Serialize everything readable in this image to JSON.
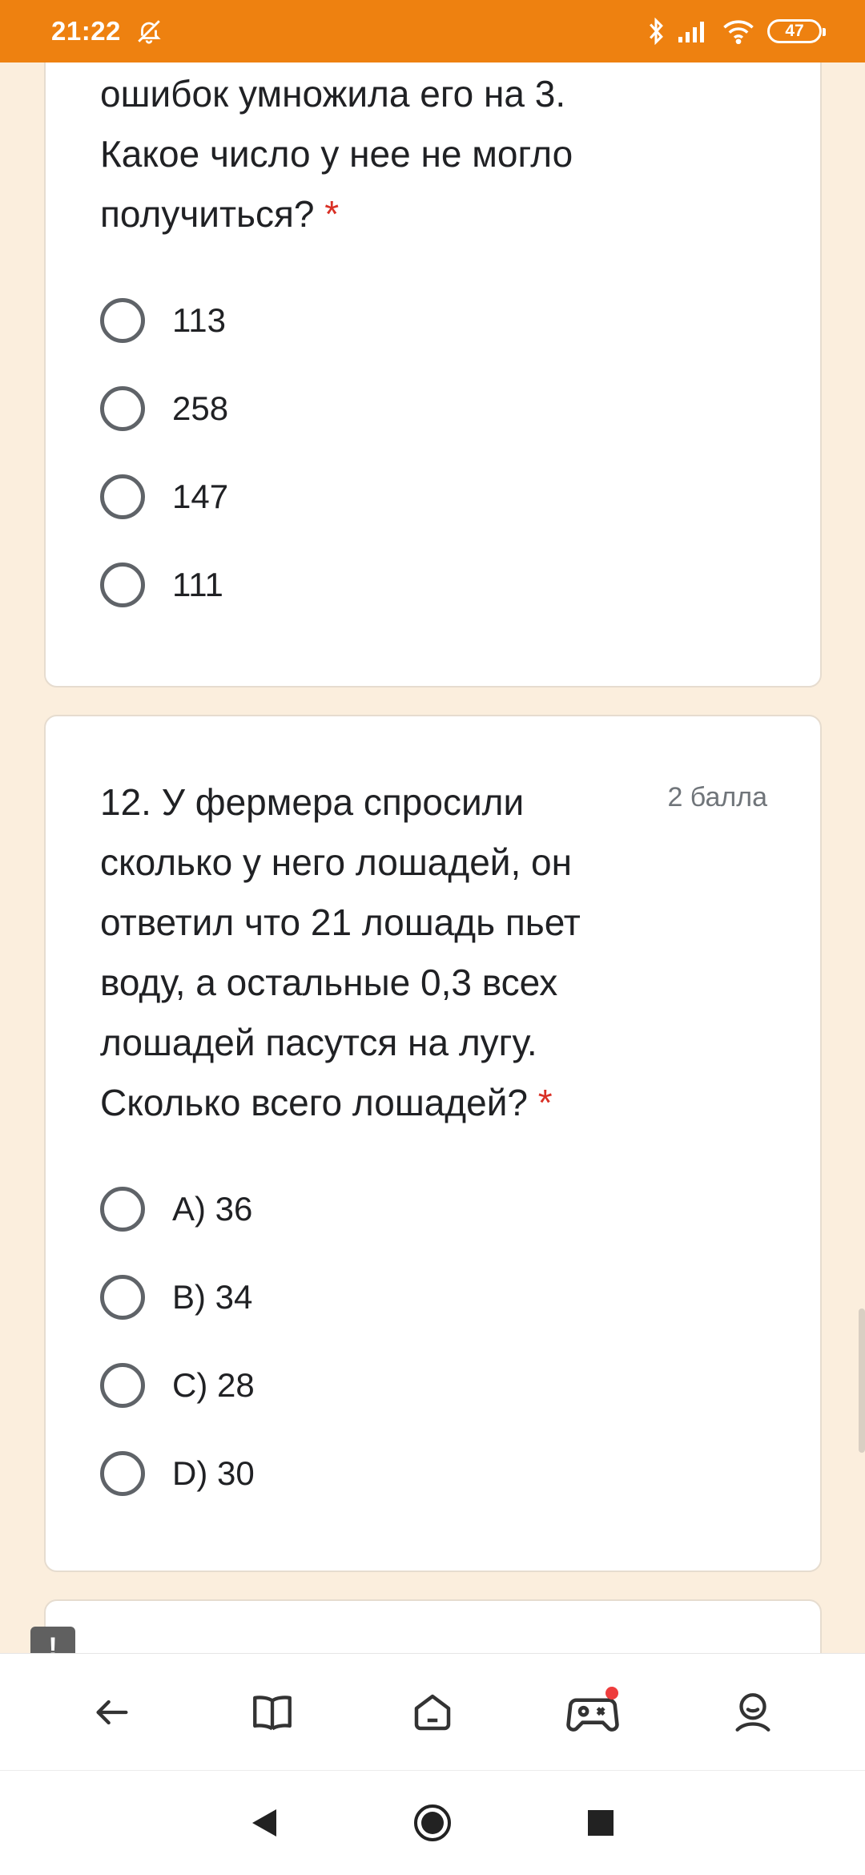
{
  "status_bar": {
    "time": "21:22",
    "battery": "47",
    "icons": [
      "mute-bell-icon",
      "bluetooth-icon",
      "signal-icon",
      "wifi-icon",
      "battery-icon"
    ]
  },
  "question_11": {
    "text_lines": [
      "ошибок умножила его на 3.",
      "Какое число у нее не могло",
      "получиться?"
    ],
    "required_mark": "*",
    "options": [
      "113",
      "258",
      "147",
      "111"
    ]
  },
  "question_12": {
    "text_lines": [
      "12. У фермера спросили",
      "сколько у него лошадей, он",
      "ответил что 21 лошадь пьет",
      "воду, а остальные 0,3 всех",
      "лошадей пасутся на лугу.",
      "Сколько всего лошадей?"
    ],
    "required_mark": "*",
    "points": "2 балла",
    "options": [
      "A) 36",
      "B) 34",
      "C) 28",
      "D) 30"
    ]
  },
  "feedback_button": {
    "label": "!"
  },
  "bottom_nav": {
    "items": [
      "back-arrow-icon",
      "book-icon",
      "home-icon",
      "gamepad-icon",
      "profile-icon"
    ]
  },
  "system_nav": {
    "items": [
      "back-triangle-icon",
      "home-circle-icon",
      "recents-square-icon"
    ]
  },
  "colors": {
    "accent": "#ee8110",
    "background": "#fbeedd",
    "required": "#d93025"
  }
}
